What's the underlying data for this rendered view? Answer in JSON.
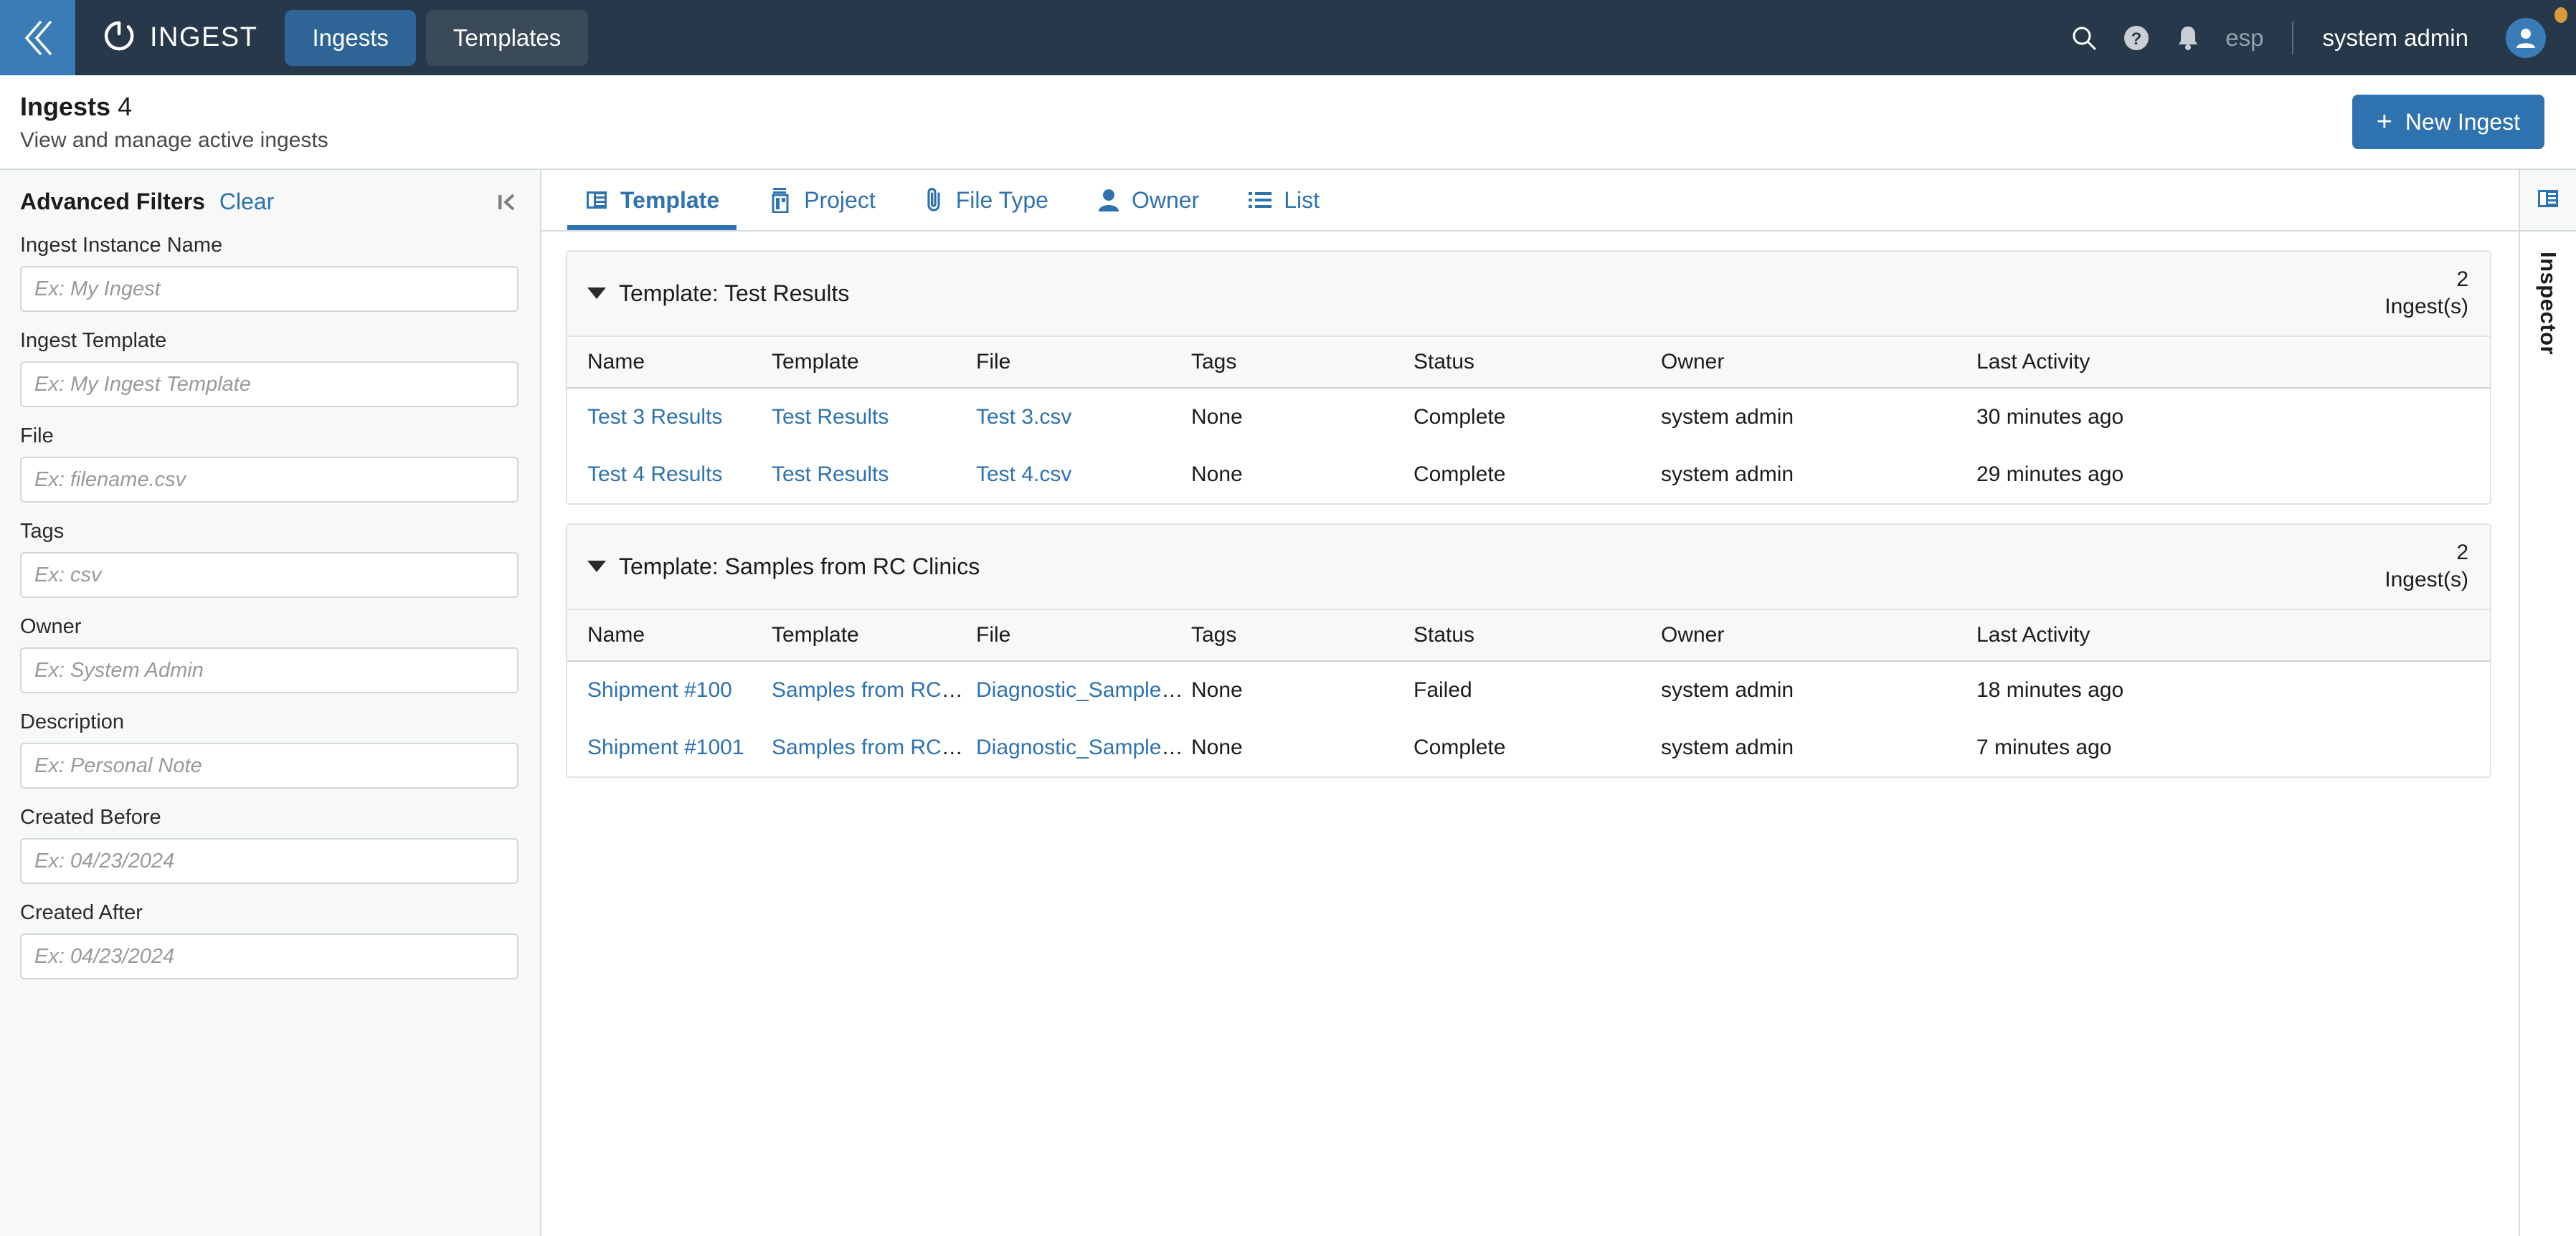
{
  "topnav": {
    "back_icon": "collapse-left-chevrons-icon",
    "brand": "INGEST",
    "tabs": [
      {
        "label": "Ingests",
        "active": true
      },
      {
        "label": "Templates",
        "active": false
      }
    ],
    "search_icon": "search-icon",
    "help_icon": "help-circle-icon",
    "notification_icon": "bell-icon",
    "language": "esp",
    "separator": "|",
    "user": "system admin",
    "avatar_icon": "user-avatar-icon"
  },
  "pagehead": {
    "title": "Ingests",
    "count": "4",
    "subtitle": "View and manage active ingests",
    "new_button": "New Ingest",
    "new_button_icon": "plus-icon",
    "accent_color": "#2e72b0"
  },
  "filters": {
    "title": "Advanced Filters",
    "clear": "Clear",
    "collapse_icon": "collapse-panel-left-icon",
    "fields": [
      {
        "label": "Ingest Instance Name",
        "placeholder": "Ex: My Ingest",
        "value": ""
      },
      {
        "label": "Ingest Template",
        "placeholder": "Ex: My Ingest Template",
        "value": ""
      },
      {
        "label": "File",
        "placeholder": "Ex: filename.csv",
        "value": ""
      },
      {
        "label": "Tags",
        "placeholder": "Ex: csv",
        "value": ""
      },
      {
        "label": "Owner",
        "placeholder": "Ex: System Admin",
        "value": ""
      },
      {
        "label": "Description",
        "placeholder": "Ex: Personal Note",
        "value": ""
      },
      {
        "label": "Created Before",
        "placeholder": "Ex: 04/23/2024",
        "value": ""
      },
      {
        "label": "Created After",
        "placeholder": "Ex: 04/23/2024",
        "value": ""
      }
    ]
  },
  "tabs": [
    {
      "label": "Template",
      "icon": "template-panel-icon",
      "active": true
    },
    {
      "label": "Project",
      "icon": "project-building-icon",
      "active": false
    },
    {
      "label": "File Type",
      "icon": "paperclip-icon",
      "active": false
    },
    {
      "label": "Owner",
      "icon": "person-icon",
      "active": false
    },
    {
      "label": "List",
      "icon": "list-icon",
      "active": false
    }
  ],
  "columns": [
    "Name",
    "Template",
    "File",
    "Tags",
    "Status",
    "Owner",
    "Last Activity"
  ],
  "groups": [
    {
      "title": "Template: Test Results",
      "count": "2",
      "count_unit": "Ingest(s)",
      "expanded": true,
      "rows": [
        {
          "name": "Test 3 Results",
          "template": "Test Results",
          "file": "Test 3.csv",
          "tags": "None",
          "status": "Complete",
          "owner": "system admin",
          "last_activity": "30 minutes ago"
        },
        {
          "name": "Test 4 Results",
          "template": "Test Results",
          "file": "Test 4.csv",
          "tags": "None",
          "status": "Complete",
          "owner": "system admin",
          "last_activity": "29 minutes ago"
        }
      ]
    },
    {
      "title": "Template: Samples from RC Clinics",
      "count": "2",
      "count_unit": "Ingest(s)",
      "expanded": true,
      "rows": [
        {
          "name": "Shipment #100",
          "template": "Samples from RC Cli...",
          "file": "Diagnostic_Samples...",
          "tags": "None",
          "status": "Failed",
          "owner": "system admin",
          "last_activity": "18 minutes ago"
        },
        {
          "name": "Shipment #1001",
          "template": "Samples from RC Cli...",
          "file": "Diagnostic_Samples...",
          "tags": "None",
          "status": "Complete",
          "owner": "system admin",
          "last_activity": "7 minutes ago"
        }
      ]
    }
  ],
  "inspector": {
    "label": "Inspector",
    "icon": "inspector-panel-icon"
  }
}
